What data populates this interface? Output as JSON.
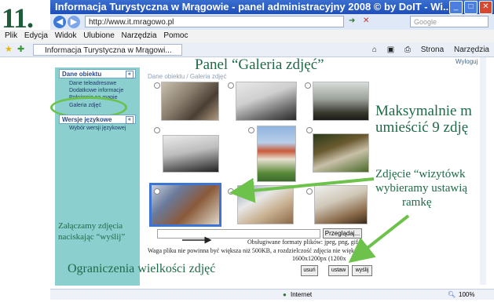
{
  "step_number": "11.",
  "window": {
    "title": "Informacja Turystyczna w Mrągowie - panel administracyjny 2008 © by DoIT - Wi...",
    "minimize": "_",
    "maximize": "□",
    "close": "✕"
  },
  "address": {
    "url": "http://www.it.mragowo.pl",
    "search_placeholder": "Google"
  },
  "menu": [
    "Plik",
    "Edycja",
    "Widok",
    "Ulubione",
    "Narzędzia",
    "Pomoc"
  ],
  "tab": {
    "label": "Informacja Turystyczna w Mrągowi..."
  },
  "toolbar": {
    "strona": "Strona",
    "narzedzia": "Narzędzia"
  },
  "panel": {
    "title": "Panel “Galeria zdjęć”",
    "logout": "Wyloguj",
    "breadcrumb": "Dane obiektu / Galeria zdjęć"
  },
  "sidebar": {
    "group1_title": "Dane obiektu",
    "items": [
      "Dane teleadresowe",
      "Dodatkowe informacje",
      "Położenie na mapie",
      "Galeria zdjęć"
    ],
    "group2_title": "Wersje językowe",
    "items2": [
      "Wybór wersji językowej"
    ]
  },
  "annotations": {
    "max_line1": "Maksymalnie m",
    "max_line2": "umieścić 9 zdję",
    "card_line1": "Zdjęcie “wizytówk",
    "card_line2": "wybieramy ustawią",
    "card_line3": "ramkę",
    "attach_line1": "Załączamy zdjęcia",
    "attach_line2": "naciskając “wyślij”",
    "limits": "Ograniczenia wielkości zdjęć"
  },
  "upload": {
    "browse": "Przeglądaj...",
    "formats": "Obsługiwane formaty plików: jpeg, png, gif",
    "size_limit": "Waga pliku nie powinna być większa niż 500KB, a rozdzielczość zdjęcia nie większa",
    "resolution": "1600x1200px (1200x",
    "delete_btn": "usuń",
    "set_btn": "ustaw",
    "send_btn": "wyślij"
  },
  "status": {
    "zone": "Internet",
    "zoom": "100%"
  },
  "colors": {
    "accent_green": "#1f6a48",
    "sidebar_bg": "#8ccfcf",
    "highlight": "#6cc24a",
    "selection": "#3c73d6"
  }
}
